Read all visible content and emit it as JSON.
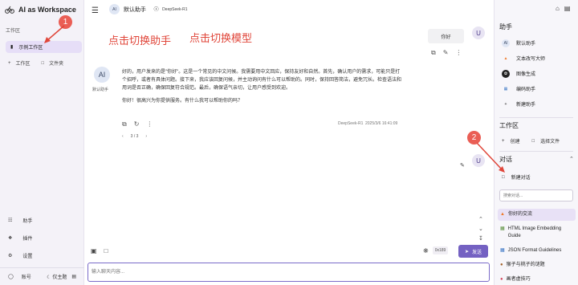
{
  "app": {
    "title": "AI as Workspace"
  },
  "workspace": {
    "section_label": "工作区",
    "items": [
      {
        "label": "示例工作区"
      }
    ],
    "add_workspace": "工作区",
    "folder": "文件夹"
  },
  "left_menu": [
    {
      "label": "助手",
      "icon": "assistant-icon"
    },
    {
      "label": "插件",
      "icon": "plugin-icon"
    },
    {
      "label": "设置",
      "icon": "gear-icon"
    }
  ],
  "account": {
    "label": "账号",
    "theme": "仅主题"
  },
  "topbar": {
    "assistant_avatar": "AI",
    "assistant_name": "默认助手",
    "model_name": "DeepSeek-R1"
  },
  "annotations": {
    "switch_assistant": "点击切换助手",
    "switch_model": "点击切换模型",
    "badge1": "1",
    "badge2": "2"
  },
  "chat": {
    "user_message": "你好",
    "user_avatar": "U",
    "ai_avatar": "AI",
    "ai_name": "默认助手",
    "ai_paragraph1": "好的，用户发来的是\"你好\"。这是一个常见的中文问候。我需要用中文回应，保持友好和自然。首先，确认用户的需求，可能只是打个招呼，或者有具体问题。接下来，我应该回复问候，并主动询问有什么可以帮助的。同时，保持回答简洁，避免冗长。检查语法和用词是否正确，确保回复符合规范。最后，确保语气亲切，让用户感受到欢迎。",
    "ai_paragraph2": "你好！很高兴为你提供服务。有什么我可以帮助你的吗？",
    "meta_model": "DeepSeek-R1",
    "meta_time": "2025/3/6 16:41:09",
    "pager": "3 / 3",
    "second_user_avatar": "U"
  },
  "composer": {
    "token_count": "0x189",
    "send_label": "发送",
    "placeholder": "输入聊天内容..."
  },
  "right": {
    "assistants_title": "助手",
    "assistants": [
      {
        "label": "默认助手",
        "icon": "ai-avatar-icon",
        "color": "#dfe6f4"
      },
      {
        "label": "文本改写大师",
        "icon": "flame-icon",
        "color": "#ffe1c7"
      },
      {
        "label": "图像生成",
        "icon": "openai-icon",
        "color": "#222222"
      },
      {
        "label": "编码助手",
        "icon": "code-icon",
        "color": "#e5eef9"
      }
    ],
    "new_assistant": "新建助手",
    "workspace_title": "工作区",
    "create": "创建",
    "select_file": "选择文件",
    "topics_title": "对话",
    "new_topic": "新建对话",
    "search_placeholder": "搜索对话...",
    "topics": [
      {
        "label": "你好的交流",
        "icon": "flame-icon"
      },
      {
        "label": "HTML Image Embedding Guide",
        "icon": "doc-icon"
      },
      {
        "label": "JSON Format Guidelines",
        "icon": "doc-icon"
      },
      {
        "label": "猴子与桃子的谜题",
        "icon": "monkey-icon"
      },
      {
        "label": "画者虚技巧",
        "icon": "art-icon"
      }
    ]
  }
}
